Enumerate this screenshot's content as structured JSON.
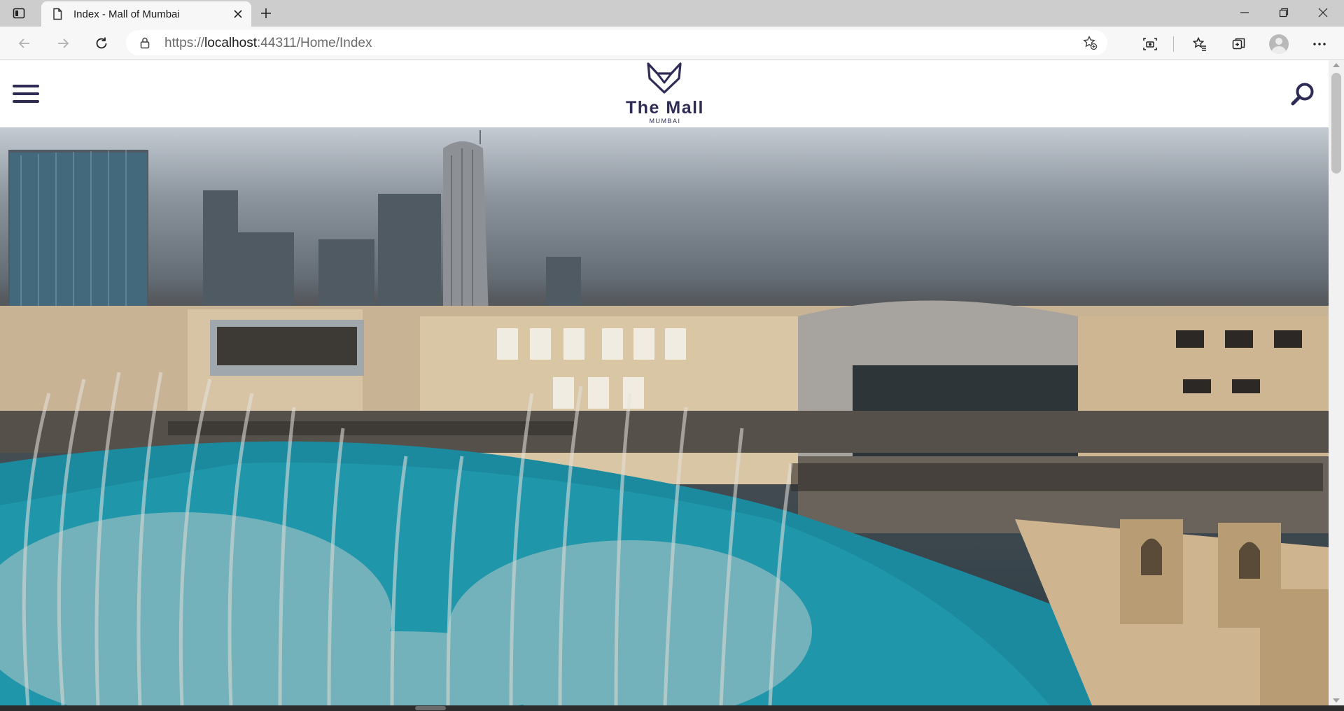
{
  "browser": {
    "tab": {
      "title": "Index - Mall of Mumbai"
    },
    "address": {
      "scheme": "https://",
      "host": "localhost",
      "rest": ":44311/Home/Index"
    }
  },
  "site": {
    "brand": {
      "name": "The Mall",
      "sub": "MUMBAI"
    }
  },
  "hero": {
    "image_alt": "Mall waterfront with fountains and city skyline"
  },
  "colors": {
    "brand": "#2e2b55",
    "water": "#1b8a9e",
    "facade": "#c8b394"
  }
}
